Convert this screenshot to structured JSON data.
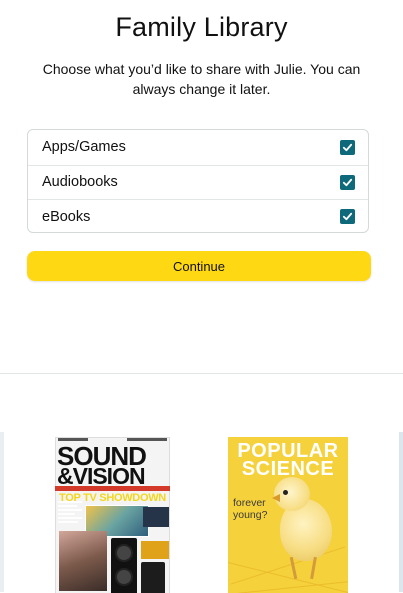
{
  "header": {
    "title": "Family Library",
    "subtitle": "Choose what you’d like to share with Julie. You can always change it later."
  },
  "options": [
    {
      "label": "Apps/Games",
      "checked": true
    },
    {
      "label": "Audiobooks",
      "checked": true
    },
    {
      "label": "eBooks",
      "checked": true
    }
  ],
  "continue_label": "Continue",
  "colors": {
    "accent_button": "#ffd814",
    "checkbox": "#0e6a7a"
  },
  "covers": {
    "sound_vision": {
      "masthead_line1": "SOUND",
      "masthead_line2": "&VISION",
      "headline": "TOP TV SHOWDOWN"
    },
    "popular_science": {
      "masthead": "POPULAR SCIENCE",
      "tagline": "forever young?"
    }
  }
}
